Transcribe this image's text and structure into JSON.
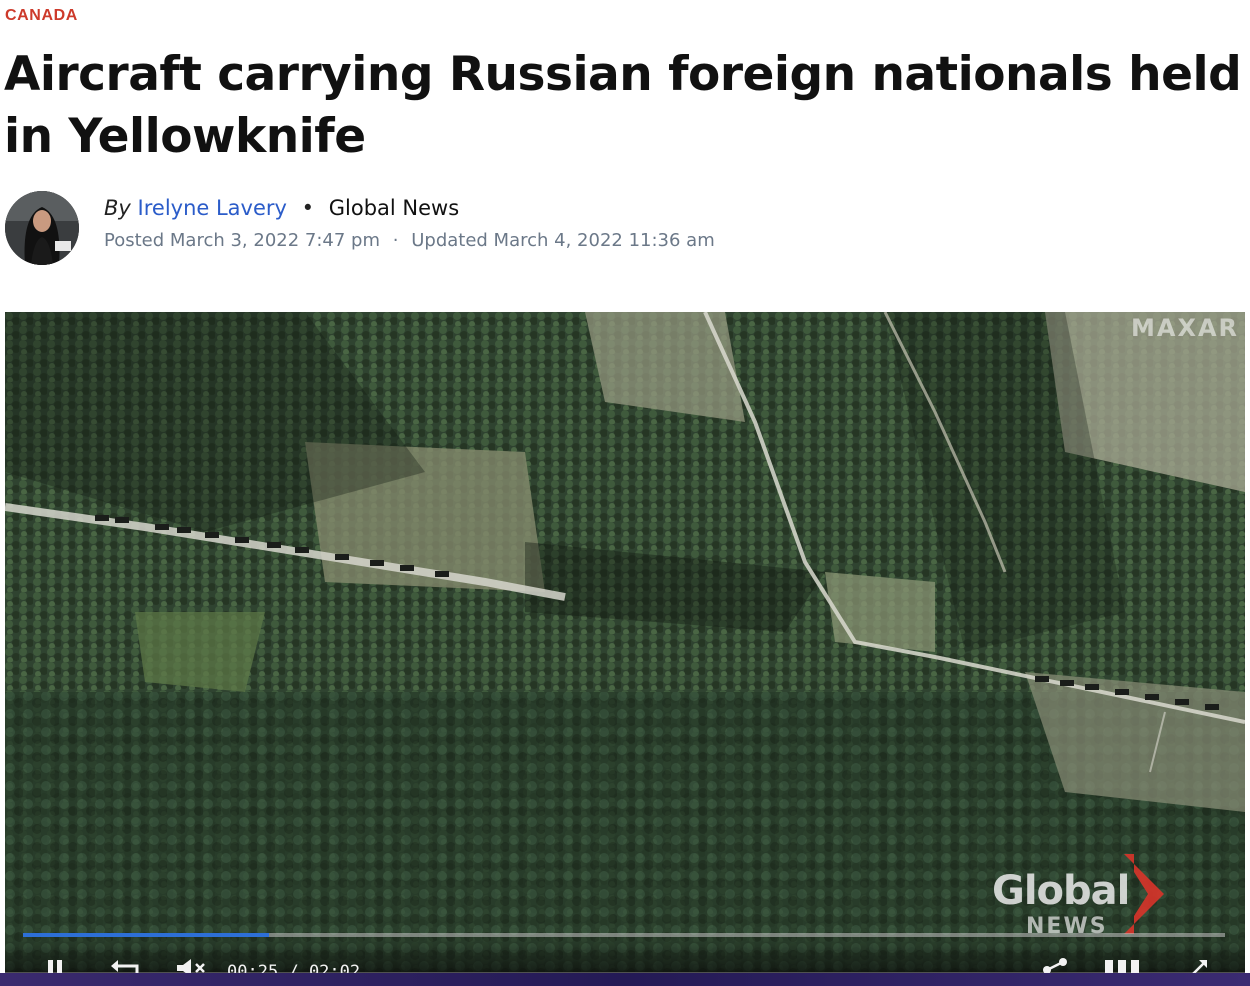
{
  "article": {
    "category": "CANADA",
    "headline": "Aircraft carrying Russian foreign nationals held in Yellowknife",
    "byline_prefix": "By",
    "author": "Irelyne Lavery",
    "separator": "•",
    "outlet": "Global News",
    "posted": "Posted March 3, 2022 7:47 pm",
    "date_separator": "·",
    "updated": "Updated March 4, 2022 11:36 am"
  },
  "video": {
    "watermark": "MAXAR",
    "logo_word": "Global",
    "logo_sub": "NEWS",
    "progress_fraction": 0.205,
    "time_current": "00:25",
    "time_separator": "/",
    "time_total": "02:02",
    "controls": {
      "play_pause_icon": "pause-icon",
      "replay_icon": "replay-icon",
      "volume_icon": "mute-icon",
      "share_icon": "share-icon",
      "chapters_icon": "chapters-icon",
      "fullscreen_icon": "fullscreen-icon"
    }
  },
  "colors": {
    "category": "#cd3a2b",
    "author_link": "#2b5cc9",
    "dates": "#6b7888",
    "progress": "#2d6fd6",
    "logo_accent": "#d8342a"
  }
}
